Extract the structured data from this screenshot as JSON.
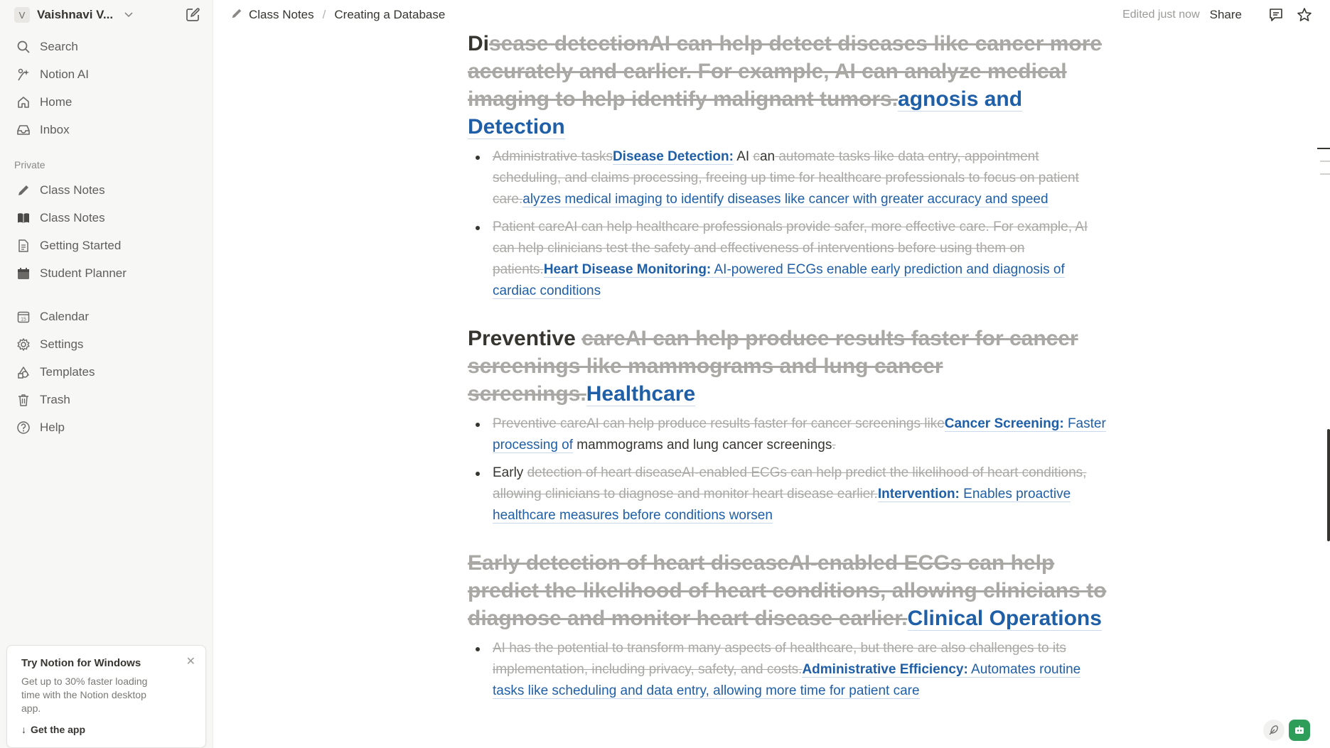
{
  "sidebar": {
    "workspace": {
      "avatar_letter": "V",
      "name": "Vaishnavi V..."
    },
    "nav": [
      {
        "label": "Search",
        "icon": "search-icon"
      },
      {
        "label": "Notion AI",
        "icon": "notion-ai-icon"
      },
      {
        "label": "Home",
        "icon": "home-icon"
      },
      {
        "label": "Inbox",
        "icon": "inbox-icon"
      }
    ],
    "private_label": "Private",
    "private": [
      {
        "label": "Class Notes",
        "icon": "pencil-icon"
      },
      {
        "label": "Class Notes",
        "icon": "book-icon"
      },
      {
        "label": "Getting Started",
        "icon": "document-icon"
      },
      {
        "label": "Student Planner",
        "icon": "calendar-page-icon"
      }
    ],
    "tools": [
      {
        "label": "Calendar",
        "icon": "calendar-icon"
      },
      {
        "label": "Settings",
        "icon": "gear-icon"
      },
      {
        "label": "Templates",
        "icon": "templates-icon"
      },
      {
        "label": "Trash",
        "icon": "trash-icon"
      },
      {
        "label": "Help",
        "icon": "help-icon"
      }
    ],
    "promo": {
      "title": "Try Notion for Windows",
      "body": "Get up to 30% faster loading time with the Notion desktop app.",
      "link": "Get the app"
    }
  },
  "topbar": {
    "breadcrumb": [
      "Class Notes",
      "Creating a Database"
    ],
    "separator": "/",
    "edited": "Edited just now",
    "share": "Share"
  },
  "doc": {
    "h1": {
      "norm": "Di",
      "strike": "sease detectionAI can help detect diseases like cancer more accurately and earlier. For example, AI can analyze medical imaging to help identify malignant tumors.",
      "ins": "agnosis and Detection"
    },
    "b1": {
      "strike1": "Administrative tasks",
      "ins_bold": "Disease Detection:",
      "norm1": " AI ",
      "strike2": "c",
      "norm2": "an",
      "strike3": " automate tasks like data entry, appointment scheduling, and claims processing, freeing up time for healthcare professionals to focus on patient care.",
      "ins": "alyzes medical imaging to identify diseases like cancer with greater accuracy and speed"
    },
    "b2": {
      "strike": "Patient careAI can help healthcare professionals provide safer, more effective care. For example, AI can help clinicians test the safety and effectiveness of interventions before using them on patients.",
      "ins_bold": "Heart Disease Monitoring:",
      "ins": " AI-powered ECGs enable early prediction and diagnosis of cardiac conditions"
    },
    "h2": {
      "norm": "Preventive ",
      "strike": "careAI can help produce results faster for cancer screenings like mammograms and lung cancer screenings.",
      "ins": "Healthcare"
    },
    "b3": {
      "strike": "Preventive careAI can help produce results faster for cancer screenings like",
      "ins_bold": "Cancer Screening:",
      "ins": " Faster processing of",
      "norm": " mammograms and lung cancer screenings",
      "strike_end": "."
    },
    "b4": {
      "norm": "Early ",
      "strike": "detection of heart diseaseAI-enabled ECGs can help predict the likelihood of heart conditions, allowing clinicians to diagnose and monitor heart disease earlier.",
      "ins_bold": "Intervention:",
      "ins": " Enables proactive healthcare measures before conditions worsen"
    },
    "h3": {
      "strike": "Early detection of heart diseaseAI-enabled ECGs can help predict the likelihood of heart conditions, allowing clinicians to diagnose and monitor heart disease earlier.",
      "ins": "Clinical Operations"
    },
    "b5": {
      "strike": "AI has the potential to transform many aspects of healthcare, but there are also challenges to its implementation, including privacy, safety, and costs.",
      "ins_bold": "Administrative Efficiency:",
      "ins": " Automates routine tasks like scheduling and data entry, allowing more time for patient care"
    }
  }
}
